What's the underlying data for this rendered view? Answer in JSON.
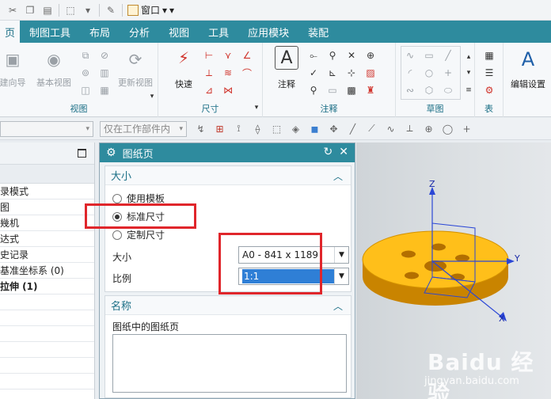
{
  "qat": {
    "window_label": "窗口"
  },
  "tabs": [
    "页",
    "制图工具",
    "布局",
    "分析",
    "视图",
    "工具",
    "应用模块",
    "装配"
  ],
  "ribbon": {
    "view_group": {
      "name": "视图",
      "btn1": "建向导",
      "btn2": "基本视图",
      "btn3": "更新视图"
    },
    "dim_group": {
      "name": "尺寸",
      "quick": "快速"
    },
    "note_group": {
      "name": "注释",
      "note": "注释"
    },
    "sketch_group": {
      "name": "草图"
    },
    "table_group": {
      "name": "表"
    },
    "edit_settings": "编辑设置"
  },
  "selbar": {
    "filter_placeholder": "",
    "scope": "仅在工作部件内"
  },
  "navigator": {
    "rows": [
      "录模式",
      "图",
      "幾机",
      "达式",
      "史记录",
      "基准坐标系 (0)",
      "拉伸 (1)",
      "",
      "",
      "",
      "",
      "",
      ""
    ]
  },
  "dialog": {
    "title": "图纸页",
    "size_section": {
      "title": "大小",
      "opt_template": "使用模板",
      "opt_standard": "标准尺寸",
      "opt_custom": "定制尺寸",
      "size_label": "大小",
      "size_value": "A0 - 841 x 1189",
      "scale_label": "比例",
      "scale_value": "1:1"
    },
    "name_section": {
      "title": "名称",
      "list_label": "图纸中的图纸页"
    }
  },
  "graphics": {
    "axis_z": "Z",
    "axis_y": "Y",
    "axis_x": "X"
  },
  "watermark": {
    "brand": "Baidu 经验",
    "url": "jingyan.baidu.com"
  }
}
